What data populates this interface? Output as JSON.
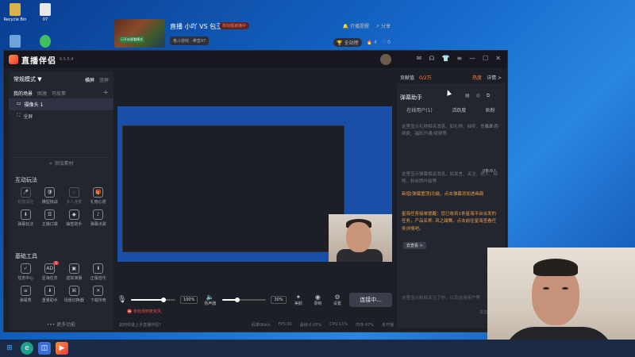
{
  "desktop": {
    "icons": [
      {
        "label": "Recycle Bin",
        "color": "#d9b34a"
      },
      {
        "label": "07",
        "color": "#e8e8e8"
      },
      {
        "label": "",
        "color": "#6fa2d8"
      },
      {
        "label": "",
        "color": "#3fbf5f"
      }
    ]
  },
  "app": {
    "title": "直播伴侣",
    "version": "6.5.5.4",
    "window_controls": [
      "message-icon",
      "headset-icon",
      "shirt-icon",
      "menu-icon",
      "minimize-icon",
      "maximize-icon",
      "close-icon"
    ]
  },
  "left": {
    "mode_label": "常规模式 ▼",
    "orient_tabs": [
      "横屏",
      "竖屏"
    ],
    "scene_tabs": [
      "我的场景",
      "图激",
      "可故素"
    ],
    "add_scene": "+",
    "sources": [
      {
        "label": "摄像头 1",
        "selected": true
      },
      {
        "label": "全屏",
        "selected": false
      }
    ],
    "add_source_label": "+ 添加素材",
    "interactive_title": "互动玩法",
    "interactive_items": [
      {
        "label": "轮鼓探险",
        "icon": "🎤",
        "dim": true
      },
      {
        "label": "横型挑战",
        "icon": "🛡",
        "dim": false
      },
      {
        "label": "多人连麦",
        "icon": "⚔",
        "dim": true
      },
      {
        "label": "礼物心愿",
        "icon": "🎁",
        "dim": false
      },
      {
        "label": "弹幕玩法",
        "icon": "⬇",
        "dim": false
      },
      {
        "label": "主播口袋",
        "icon": "☰",
        "dim": false
      },
      {
        "label": "抽签助手",
        "icon": "◆",
        "dim": false
      },
      {
        "label": "弹幕点歌",
        "icon": "♪",
        "dim": false
      }
    ],
    "tools_title": "基础工具",
    "tool_items": [
      {
        "label": "任务中心",
        "icon": "✓",
        "badge": ""
      },
      {
        "label": "星海任务",
        "icon": "AD",
        "badge": "1"
      },
      {
        "label": "虚拟演播",
        "icon": "▣",
        "badge": ""
      },
      {
        "label": "正版音乐",
        "icon": "⬇",
        "badge": ""
      },
      {
        "label": "弹幕秀",
        "icon": "≡",
        "badge": ""
      },
      {
        "label": "重量助手",
        "icon": "⬇",
        "badge": ""
      },
      {
        "label": "场景切换器",
        "icon": "⌘",
        "badge": ""
      },
      {
        "label": "下载传奇",
        "icon": "✕",
        "badge": ""
      }
    ],
    "more_label": "••• 更多功能"
  },
  "stream": {
    "title": "直播 小吖 VS 包王",
    "live_badge": "靠标题被播中",
    "cover_tag": "已开启观看模式",
    "category": "格斗游戏 · 拳皇97",
    "actions": [
      "开播提醒",
      "分享"
    ],
    "stats": {
      "label": "全站榜",
      "likes": "4",
      "hearts": "0"
    }
  },
  "controls": {
    "mic_volume_pct": 0.72,
    "mic_volume_text": "100%",
    "speaker_label": "扬声器",
    "speaker_volume_pct": 0.35,
    "speaker_volume_text": "30%",
    "buttons": [
      {
        "label": "美颜",
        "icon": "✦"
      },
      {
        "label": "录制",
        "icon": "◉"
      },
      {
        "label": "设置",
        "icon": "⚙"
      }
    ],
    "connect_label": "连接中...",
    "error_text": "未检测到麦克风"
  },
  "status_bar": {
    "help": "如何快速上手直播伴侣?",
    "items": [
      "码率0kb/s",
      "FPS:30",
      "丢帧:0.00%",
      "CPU:11%",
      "内存:47%",
      "未开播"
    ]
  },
  "right": {
    "contrib_label": "贡献值",
    "contrib_value": "0/2万",
    "hot_label": "热度",
    "detail_label": "详情 >",
    "panel_title": "弹幕助手",
    "tabs": [
      "在线用户(1)",
      "活跃度",
      "贴粉"
    ],
    "count_top": "0.0",
    "count_mid": "0条/8人",
    "messages": [
      {
        "text": "这里显示礼物相关消息，如礼物、抽奖、贵族开通/续费、福彩开通/续费等",
        "hl": false
      },
      {
        "text": "这里显示弹幕相关消息，如发言、关注、进入、拍照、粉丝牌升级等",
        "hl": false
      },
      {
        "text": "新增[弹幕置顶]功能，点击弹幕添加进画面",
        "hl": true
      },
      {
        "text": "星海任务接单提醒：您已收到1条星海平台派发的任务，产品名称: 风之甜舞，点击前往星海查看任务详情吧。",
        "hl": true
      }
    ],
    "goto_label": "去查看 >",
    "input_hint": "这里显示粉丝关注了你，以及送场用户等",
    "send_label": "发送"
  }
}
